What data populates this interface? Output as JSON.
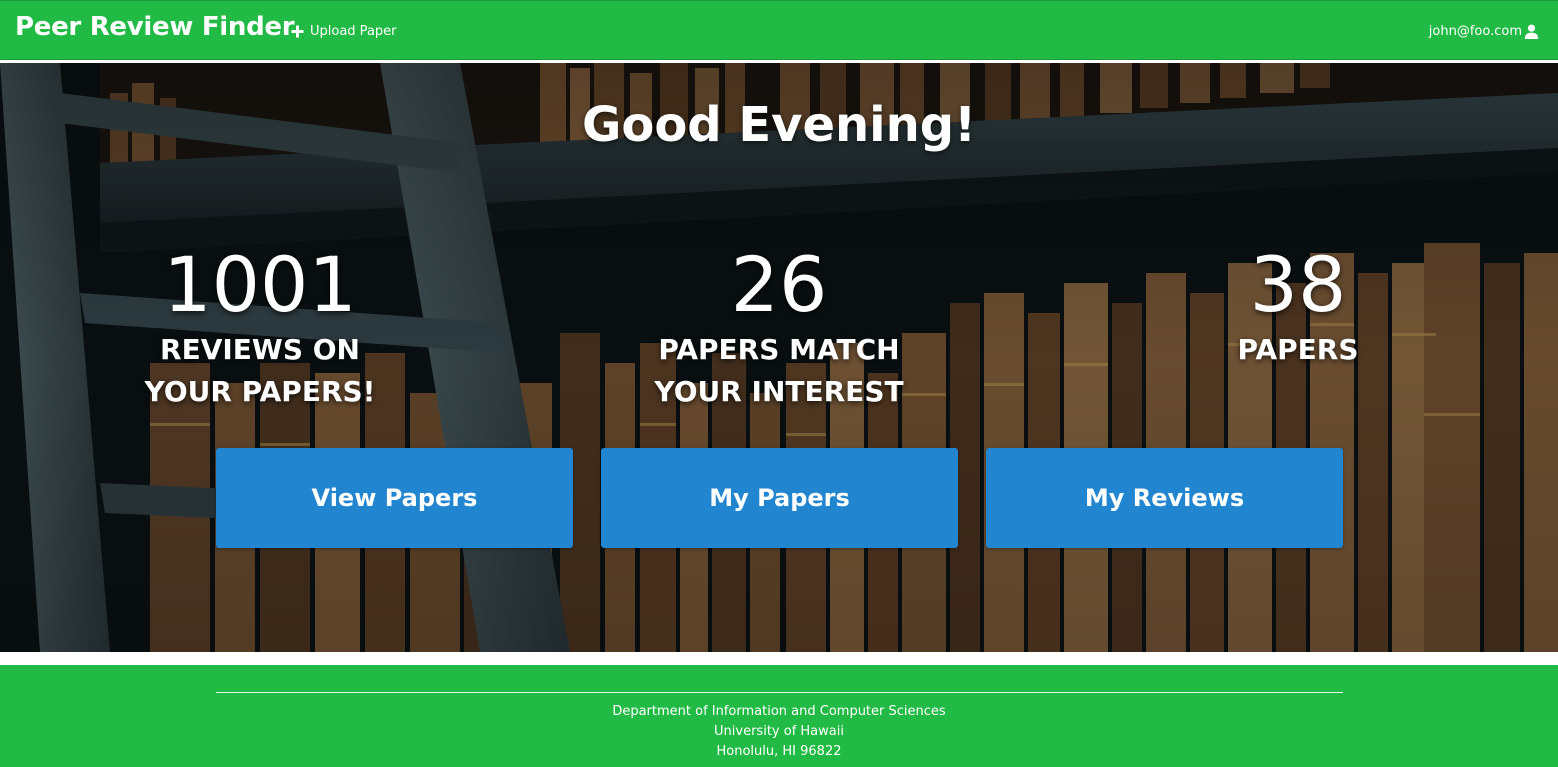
{
  "navbar": {
    "brand": "Peer Review Finder",
    "upload_label": "Upload Paper",
    "user_email": "john@foo.com"
  },
  "hero": {
    "greeting": "Good Evening!",
    "stats": [
      {
        "number": "1001",
        "label_line1": "REVIEWS ON",
        "label_line2": "YOUR PAPERS!"
      },
      {
        "number": "26",
        "label_line1": "PAPERS MATCH",
        "label_line2": "YOUR INTEREST"
      },
      {
        "number": "38",
        "label_line1": "PAPERS",
        "label_line2": ""
      }
    ],
    "buttons": {
      "view_papers": "View Papers",
      "my_papers": "My Papers",
      "my_reviews": "My Reviews"
    }
  },
  "footer": {
    "department": "Department of Information and Computer Sciences",
    "university": "University of Hawaii",
    "address": "Honolulu, HI 96822"
  },
  "colors": {
    "brand_green": "#21ba45",
    "button_blue": "#2185d0",
    "text_white": "#ffffff"
  },
  "icons": {
    "upload": "plus-icon",
    "user": "user-icon"
  }
}
